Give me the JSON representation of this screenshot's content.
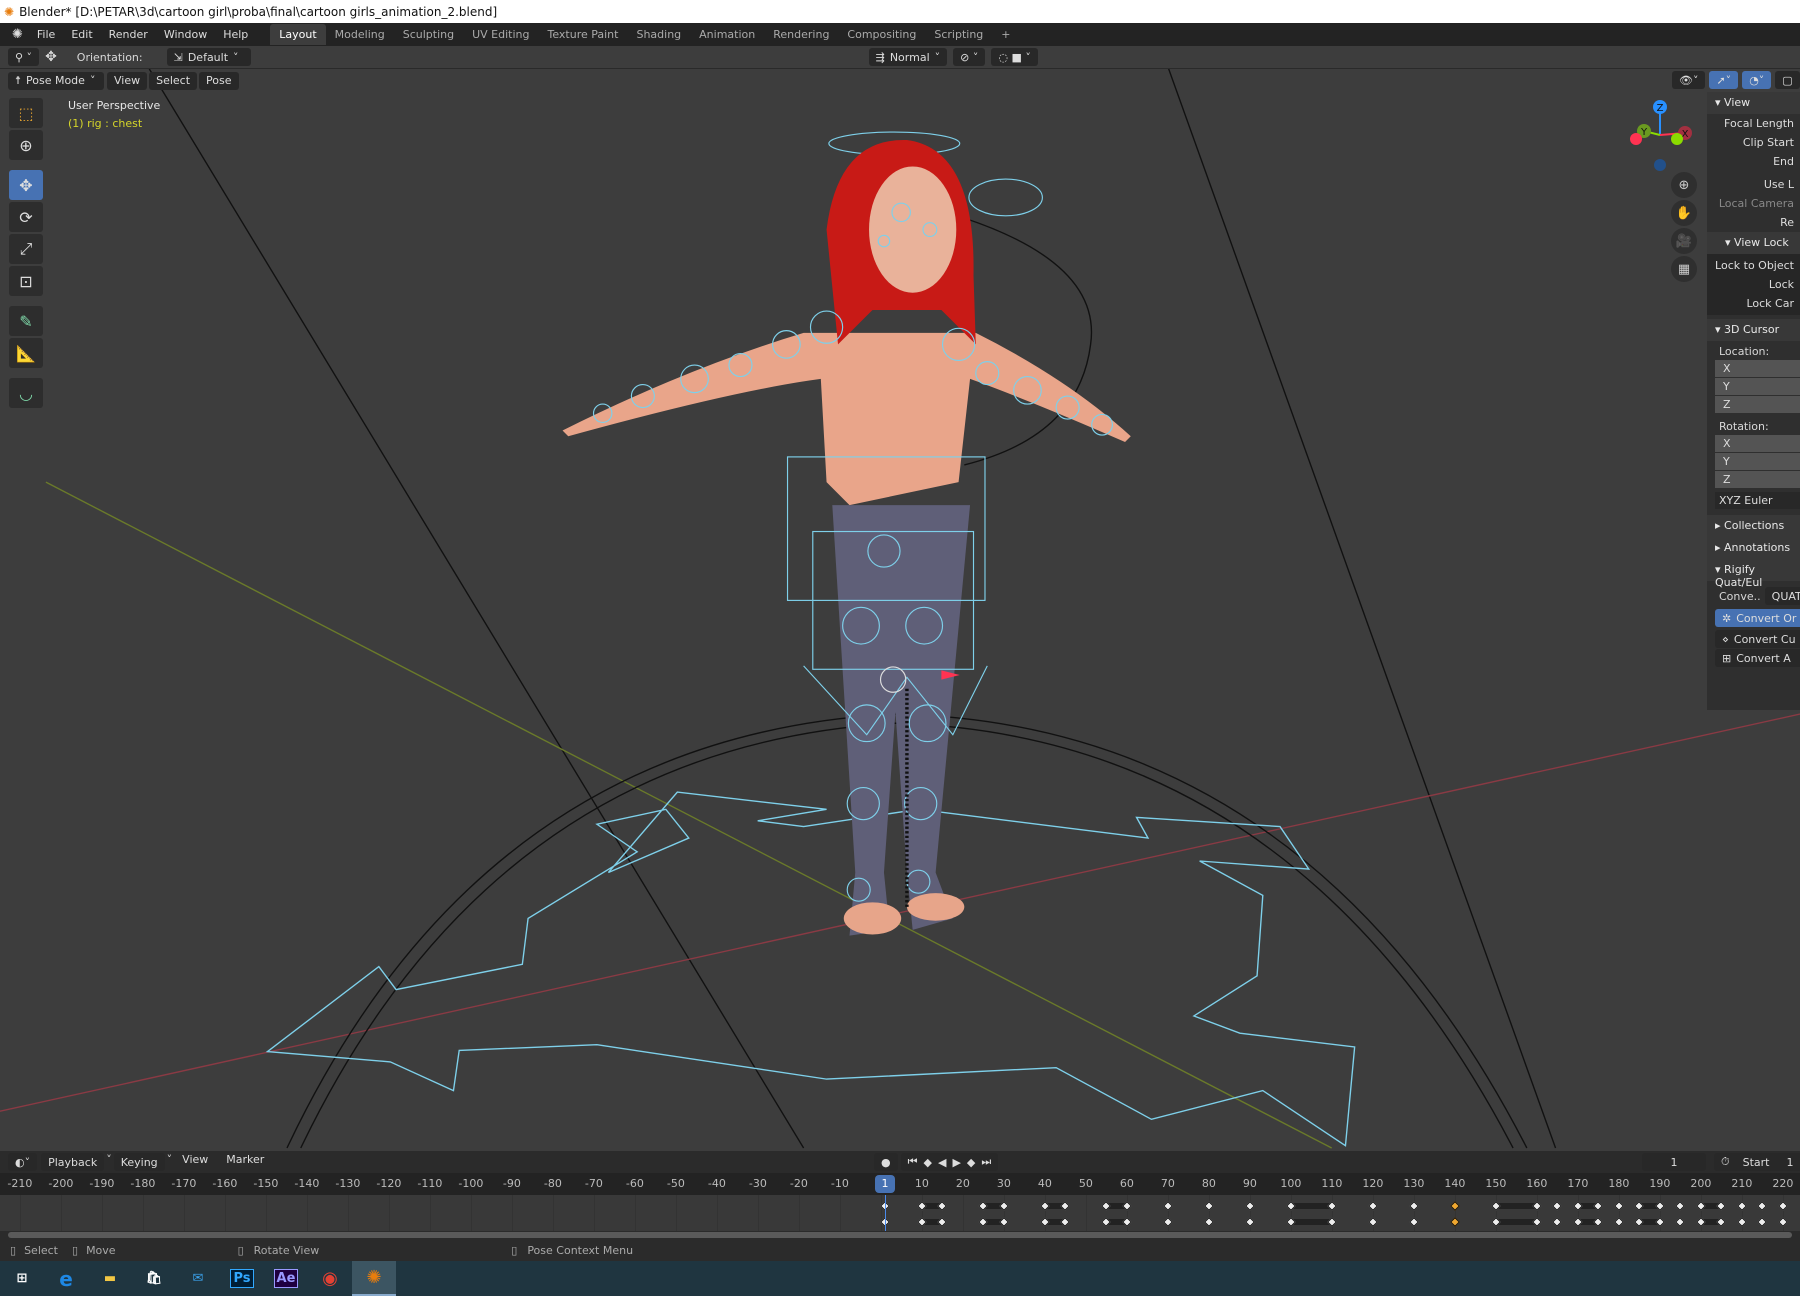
{
  "window": {
    "title": "Blender* [D:\\PETAR\\3d\\cartoon girl\\proba\\final\\cartoon girls_animation_2.blend]"
  },
  "menu": [
    "File",
    "Edit",
    "Render",
    "Window",
    "Help"
  ],
  "workspaces": [
    {
      "label": "Layout",
      "active": true
    },
    {
      "label": "Modeling"
    },
    {
      "label": "Sculpting"
    },
    {
      "label": "UV Editing"
    },
    {
      "label": "Texture Paint"
    },
    {
      "label": "Shading"
    },
    {
      "label": "Animation"
    },
    {
      "label": "Rendering"
    },
    {
      "label": "Compositing"
    },
    {
      "label": "Scripting"
    },
    {
      "label": "+"
    }
  ],
  "toolheader": {
    "orientation_label": "Orientation:",
    "orientation_value": "Default",
    "pivot": "Normal"
  },
  "viewport_header": {
    "mode": "Pose Mode",
    "menus": [
      "View",
      "Select",
      "Pose"
    ]
  },
  "viewport": {
    "perspective": "User Perspective",
    "context": "(1) rig : chest",
    "context_color": "#d6d62a"
  },
  "gizmo": {
    "axes": [
      "Z",
      "Y",
      "X"
    ],
    "colors": {
      "x": "#ff3352",
      "y": "#8bdc00",
      "z": "#2890ff"
    }
  },
  "npanel": {
    "view": {
      "header": "View",
      "focal_length": "Focal Length",
      "clip_start": "Clip Start",
      "end": "End",
      "use_local": "Use L",
      "local_camera": "Local Camera",
      "render": "Re"
    },
    "view_lock": {
      "header": "View Lock",
      "lock_to_object": "Lock to Object",
      "lock": "Lock",
      "lock_camera": "Lock Car"
    },
    "cursor": {
      "header": "3D Cursor",
      "location": "Location:",
      "rotation": "Rotation:",
      "axes": [
        "X",
        "Y",
        "Z"
      ],
      "mode": "XYZ Euler"
    },
    "collections": "Collections",
    "annotations": "Annotations",
    "rigify": {
      "header": "Rigify Quat/Eul",
      "conv_label": "Conve..",
      "conv_value": "QUATERN",
      "buttons": [
        "Convert Or",
        "Convert Cu",
        "Convert A"
      ]
    }
  },
  "timeline": {
    "menus": [
      "Playback",
      "Keying",
      "View",
      "Marker"
    ],
    "current_frame": "1",
    "start_label": "Start",
    "start_value": "1",
    "ticks": [
      -210,
      -200,
      -190,
      -180,
      -170,
      -160,
      -150,
      -140,
      -130,
      -120,
      -110,
      -100,
      -90,
      -80,
      -70,
      -60,
      -50,
      -40,
      -30,
      -20,
      -10,
      10,
      20,
      30,
      40,
      50,
      60,
      70,
      80,
      90,
      100,
      110,
      120,
      130,
      140,
      150,
      160,
      170,
      180,
      190,
      200,
      210,
      220
    ],
    "keyframes": [
      1,
      10,
      15,
      25,
      30,
      40,
      45,
      55,
      60,
      70,
      80,
      90,
      100,
      110,
      120,
      130,
      140,
      150,
      160,
      165,
      170,
      175,
      180,
      185,
      190,
      195,
      200,
      205,
      210,
      215,
      220
    ],
    "selected_keyframes": [
      140
    ],
    "holds": [
      [
        10,
        15
      ],
      [
        25,
        30
      ],
      [
        40,
        45
      ],
      [
        55,
        60
      ],
      [
        100,
        110
      ],
      [
        150,
        160
      ],
      [
        170,
        175
      ],
      [
        185,
        190
      ],
      [
        200,
        205
      ]
    ]
  },
  "status": {
    "select": "Select",
    "move": "Move",
    "rotate": "Rotate View",
    "context": "Pose Context Menu"
  },
  "taskbar": [
    "windows",
    "edge",
    "explorer",
    "store",
    "mail",
    "Ps",
    "Ae",
    "chrome",
    "blender"
  ]
}
